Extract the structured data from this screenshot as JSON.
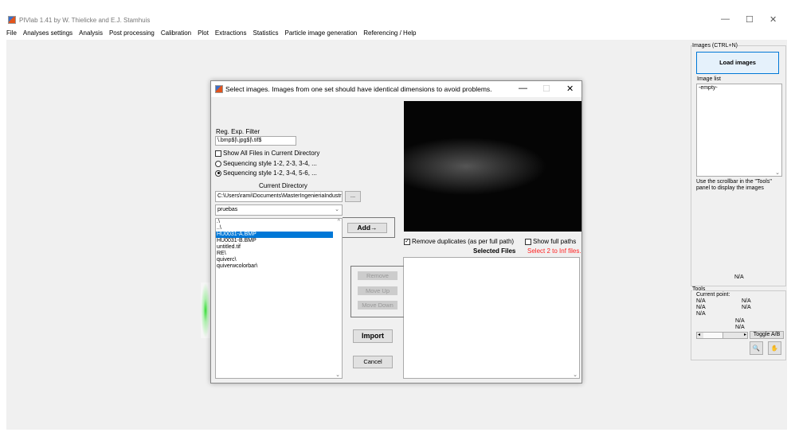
{
  "app": {
    "title": "PIVlab 1.41 by W. Thielicke and E.J. Stamhuis",
    "controls": {
      "minimize": "—",
      "maximize": "☐",
      "close": "✕"
    }
  },
  "menu": [
    "File",
    "Analyses settings",
    "Analysis",
    "Post processing",
    "Calibration",
    "Plot",
    "Extractions",
    "Statistics",
    "Particle image generation",
    "Referencing / Help"
  ],
  "dialog": {
    "title": "Select images. Images from one set should have identical dimensions to avoid problems.",
    "regexp_label": "Reg. Exp. Filter",
    "regexp_value": "\\.bmp$|\\.jpg$|\\.tif$",
    "show_all_label": "Show All Files in Current Directory",
    "seq1_label": "Sequencing style 1-2, 2-3, 3-4, ...",
    "seq2_label": "Sequencing style 1-2, 3-4, 5-6, ...",
    "current_dir_label": "Current Directory",
    "current_dir_value": "C:\\Users\\rami\\Documents\\MasterIngenieriaIndustrial\\",
    "browse_label": "...",
    "folder_value": "pruebas",
    "files": [
      ".\\",
      "..\\",
      "HU0031-A.BMP",
      "HU0031-B.BMP",
      "untitled.tif",
      "RE\\",
      "quiverc\\",
      "quiverwcolorbar\\"
    ],
    "selected_file_index": 2,
    "add_label": "Add→",
    "remove_dup_label": "Remove duplicates (as per full path)",
    "show_full_paths_label": "Show full paths",
    "selected_files_label": "Selected Files",
    "select_hint": "Select 2 to Inf files.",
    "remove_label": "Remove",
    "move_up_label": "Move Up",
    "move_down_label": "Move Down",
    "import_label": "Import",
    "cancel_label": "Cancel",
    "hint_color": "#ff0000"
  },
  "side": {
    "images_panel": "Images (CTRL+N)",
    "load_label": "Load images",
    "image_list_label": "Image list",
    "image_list_value": "-empty-",
    "scroll_hint": "Use the scrollbar in the \"Tools\" panel to display the images",
    "na": "N/A",
    "tools_panel": "Tools",
    "current_point": "Current point:",
    "na_values": [
      "N/A",
      "N/A",
      "N/A",
      "N/A",
      "N/A",
      "N/A",
      "N/A"
    ],
    "toggle_label": "Toggle A/B"
  }
}
